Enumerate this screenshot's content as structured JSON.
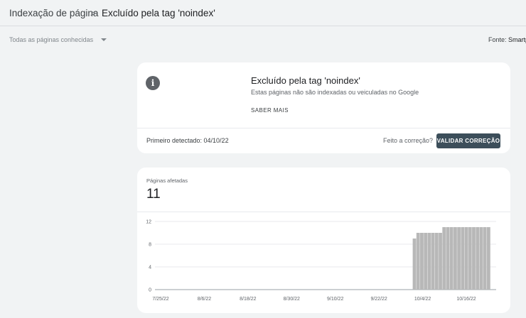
{
  "header": {
    "breadcrumb_parent": "Indexação de página",
    "breadcrumb_separator": ">",
    "breadcrumb_current": "Excluído pela tag 'noindex'"
  },
  "filters": {
    "pages_selector": "Todas as páginas conhecidas",
    "source_label": "Fonte:",
    "source_value": "Smartp"
  },
  "issue_card": {
    "title": "Excluído pela tag 'noindex'",
    "subtitle": "Estas páginas não são indexadas ou veiculadas no Google",
    "learn_more": "SABER MAIS",
    "first_detected": "Primeiro detectado: 04/10/22",
    "fixed_question": "Feito a correção?",
    "validate_button": "VALIDAR CORREÇÃO",
    "icon": "info-icon"
  },
  "affected_card": {
    "label": "Páginas afetadas",
    "count": "11"
  },
  "colors": {
    "bar": "#b8b8b8",
    "accent_button": "#3c4e5a"
  },
  "chart_data": {
    "type": "bar",
    "title": "",
    "xlabel": "",
    "ylabel": "",
    "ylim": [
      0,
      12
    ],
    "yticks": [
      "0",
      "4",
      "8",
      "12"
    ],
    "x_tick_labels": [
      "7/25/22",
      "8/6/22",
      "8/18/22",
      "8/30/22",
      "9/10/22",
      "9/22/22",
      "10/4/22",
      "10/16/22"
    ],
    "x_range": [
      "2022-07-25",
      "2022-10-25"
    ],
    "grid": true,
    "series": [
      {
        "x": [
          "2022-10-03",
          "2022-10-04",
          "2022-10-05",
          "2022-10-06",
          "2022-10-07",
          "2022-10-08",
          "2022-10-09",
          "2022-10-10",
          "2022-10-11",
          "2022-10-12",
          "2022-10-13",
          "2022-10-14",
          "2022-10-15",
          "2022-10-16",
          "2022-10-17",
          "2022-10-18",
          "2022-10-19",
          "2022-10-20",
          "2022-10-21",
          "2022-10-22",
          "2022-10-23"
        ],
        "values": [
          9,
          10,
          10,
          10,
          10,
          10,
          10,
          10,
          11,
          11,
          11,
          11,
          11,
          11,
          11,
          11,
          11,
          11,
          11,
          11,
          11
        ]
      }
    ]
  }
}
